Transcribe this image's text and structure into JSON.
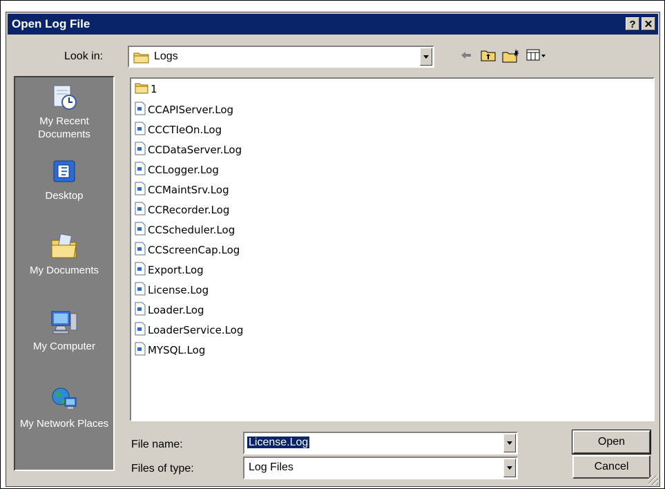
{
  "window": {
    "title": "Open Log File",
    "help_glyph": "?",
    "close_glyph": "✕"
  },
  "look_in": {
    "label": "Look in:",
    "value": "Logs"
  },
  "places": [
    {
      "label": "My Recent Documents",
      "icon": "recent-documents-icon"
    },
    {
      "label": "Desktop",
      "icon": "desktop-icon"
    },
    {
      "label": "My Documents",
      "icon": "my-documents-icon"
    },
    {
      "label": "My Computer",
      "icon": "my-computer-icon"
    },
    {
      "label": "My Network Places",
      "icon": "network-places-icon"
    }
  ],
  "files": [
    {
      "name": "1",
      "type": "folder"
    },
    {
      "name": "CCAPIServer.Log",
      "type": "file"
    },
    {
      "name": "CCCTIeOn.Log",
      "type": "file"
    },
    {
      "name": "CCDataServer.Log",
      "type": "file"
    },
    {
      "name": "CCLogger.Log",
      "type": "file"
    },
    {
      "name": "CCMaintSrv.Log",
      "type": "file"
    },
    {
      "name": "CCRecorder.Log",
      "type": "file"
    },
    {
      "name": "CCScheduler.Log",
      "type": "file"
    },
    {
      "name": "CCScreenCap.Log",
      "type": "file"
    },
    {
      "name": "Export.Log",
      "type": "file"
    },
    {
      "name": "License.Log",
      "type": "file"
    },
    {
      "name": "Loader.Log",
      "type": "file"
    },
    {
      "name": "LoaderService.Log",
      "type": "file"
    },
    {
      "name": "MYSQL.Log",
      "type": "file"
    }
  ],
  "file_name": {
    "label": "File name:",
    "value": "License.Log"
  },
  "file_type": {
    "label": "Files of type:",
    "value": "Log Files"
  },
  "buttons": {
    "open": "Open",
    "cancel": "Cancel"
  },
  "colors": {
    "titlebar": "#0a246a",
    "dialog_face": "#d4d0c8",
    "places_bar": "#808080",
    "selection": "#0a246a"
  }
}
